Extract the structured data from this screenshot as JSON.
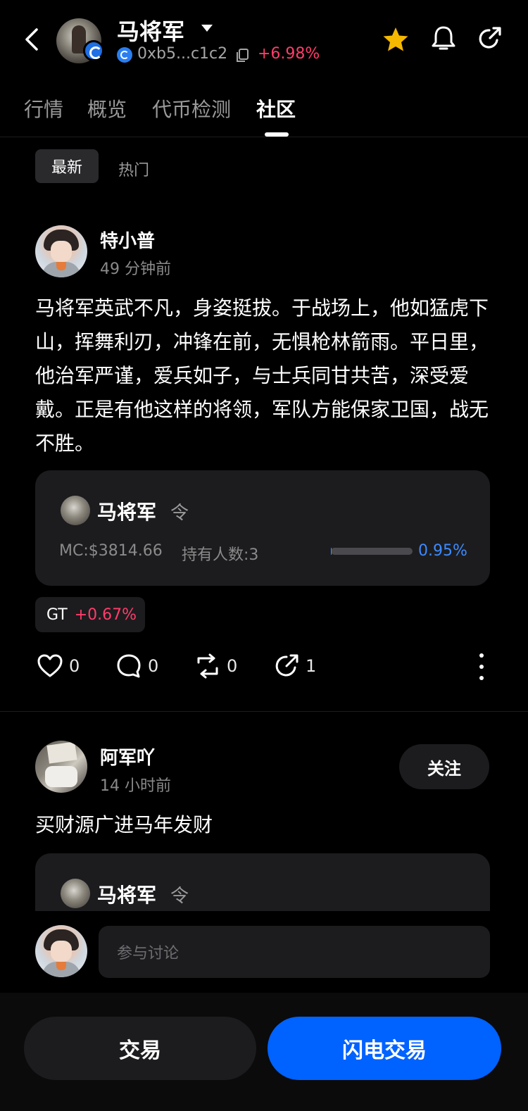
{
  "header": {
    "title": "马将军",
    "address": "0xb5...c1c2",
    "change": "+6.98%",
    "colors": {
      "up": "#ff3d6a",
      "accent": "#0062ff",
      "star": "#f5b800"
    }
  },
  "tabs": [
    {
      "label": "行情"
    },
    {
      "label": "概览"
    },
    {
      "label": "代币检测"
    },
    {
      "label": "社区"
    }
  ],
  "filters": {
    "latest": "最新",
    "hot": "热门"
  },
  "posts": [
    {
      "username": "特小普",
      "time": "49 分钟前",
      "text": "马将军英武不凡，身姿挺拔。于战场上，他如猛虎下山，挥舞利刃，冲锋在前，无惧枪林箭雨。平日里，他治军严谨，爱兵如子，与士兵同甘共苦，深受爱戴。正是有他这样的将领，军队方能保家卫国，战无不胜。",
      "card": {
        "title": "马将军",
        "sub": "令",
        "mc": "MC:$3814.66",
        "holders": "持有人数:3",
        "progress_pct": "0.95%",
        "progress_value": 0.0095
      },
      "chip": {
        "label": "GT",
        "pct": "+0.67%"
      },
      "actions": {
        "likes": "0",
        "comments": "0",
        "reposts": "0",
        "shares": "1"
      }
    },
    {
      "username": "阿军吖",
      "time": "14 小时前",
      "follow": "关注",
      "text": "买财源广进马年发财",
      "card": {
        "title": "马将军",
        "sub": "令"
      }
    }
  ],
  "comment": {
    "placeholder": "参与讨论"
  },
  "bottom": {
    "trade": "交易",
    "flash_trade": "闪电交易"
  }
}
